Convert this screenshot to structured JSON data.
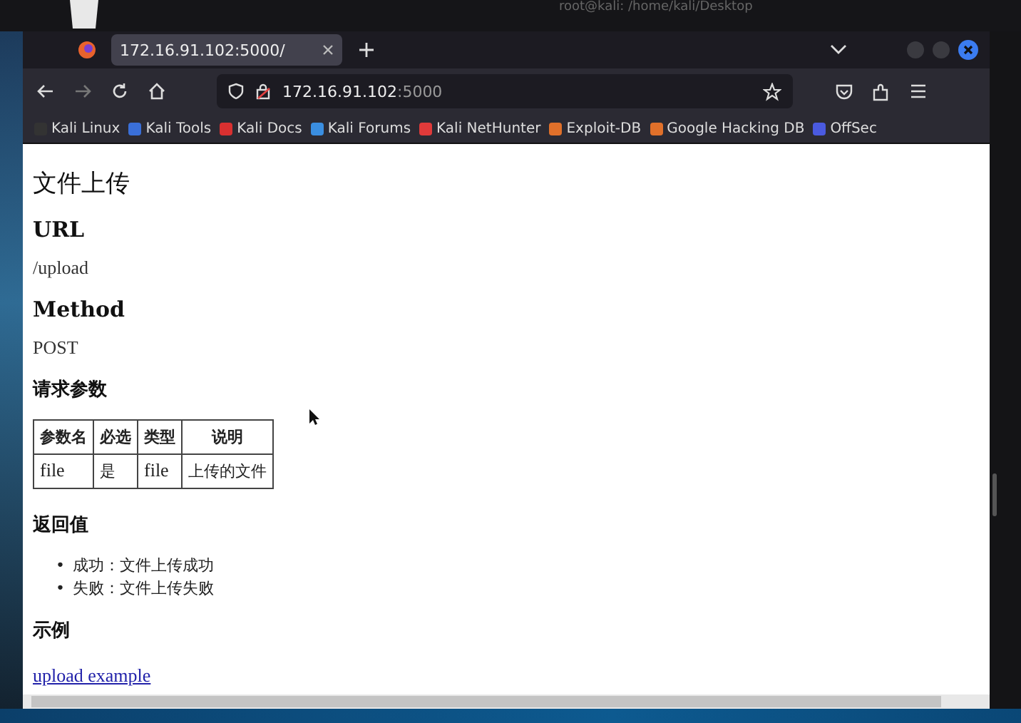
{
  "desktop": {
    "terminal_title": "root@kali: /home/kali/Desktop"
  },
  "tabs": [
    {
      "label": "172.16.91.102:5000/",
      "selected": true
    }
  ],
  "address_bar": {
    "host": "172.16.91.102",
    "port": ":5000"
  },
  "bookmarks": [
    {
      "label": "Kali Linux",
      "color": "#333333"
    },
    {
      "label": "Kali Tools",
      "color": "#3a6fd8"
    },
    {
      "label": "Kali Docs",
      "color": "#d93030"
    },
    {
      "label": "Kali Forums",
      "color": "#3a8ee0"
    },
    {
      "label": "Kali NetHunter",
      "color": "#e03a3a"
    },
    {
      "label": "Exploit-DB",
      "color": "#e0702a"
    },
    {
      "label": "Google Hacking DB",
      "color": "#e0702a"
    },
    {
      "label": "OffSec",
      "color": "#4a5ae0"
    }
  ],
  "page": {
    "title": "文件上传",
    "url_heading": "URL",
    "url": "/upload",
    "method_heading": "Method",
    "method": "POST",
    "params_heading": "请求参数",
    "table": {
      "columns": [
        "参数名",
        "必选",
        "类型",
        "说明"
      ],
      "rows": [
        [
          "file",
          "是",
          "file",
          "上传的文件"
        ]
      ]
    },
    "returns_heading": "返回值",
    "returns": [
      {
        "bullet": "•",
        "text": "成功：文件上传成功"
      },
      {
        "bullet": "•",
        "text": "失败：文件上传失败"
      }
    ],
    "example_heading": "示例",
    "example_link": "upload example"
  }
}
